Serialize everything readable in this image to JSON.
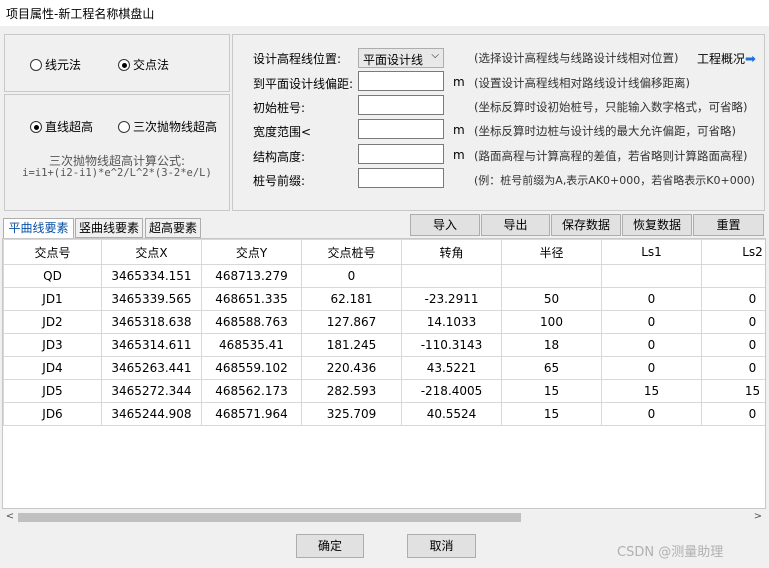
{
  "window": {
    "title": "项目属性-新工程名称棋盘山"
  },
  "modes": {
    "xianyuan": "线元法",
    "jiaodian": "交点法",
    "selected": "交点法"
  },
  "superelevation": {
    "zhixian": "直线超高",
    "sanci": "三次抛物线超高",
    "selected": "直线超高",
    "formula_title": "三次抛物线超高计算公式:",
    "formula": "i=i1+(i2-i1)*e^2/L^2*(3-2*e/L)"
  },
  "form": {
    "position_label": "设计高程线位置:",
    "position_value": "平面设计线",
    "position_hint": "(选择设计高程线与线路设计线相对位置)",
    "overview_label": "工程概况",
    "offset_label": "到平面设计线偏距:",
    "offset_unit": "m",
    "offset_hint": "(设置设计高程线相对路线设计线偏移距离)",
    "start_label": "初始桩号:",
    "start_hint": "(坐标反算时设初始桩号，只能输入数字格式，可省略)",
    "width_label": "宽度范围<",
    "width_unit": "m",
    "width_hint": "(坐标反算时边桩与设计线的最大允许偏距，可省略)",
    "struct_label": "结构高度:",
    "struct_unit": "m",
    "struct_hint": "(路面高程与计算高程的差值，若省略则计算路面高程)",
    "prefix_label": "桩号前缀:",
    "prefix_hint": "(例：桩号前缀为A,表示AK0+000，若省略表示K0+000)"
  },
  "tabs": [
    "平曲线要素",
    "竖曲线要素",
    "超高要素"
  ],
  "actions": [
    "导入",
    "导出",
    "保存数据",
    "恢复数据",
    "重置"
  ],
  "table": {
    "headers": [
      "交点号",
      "交点X",
      "交点Y",
      "交点桩号",
      "转角",
      "半径",
      "Ls1",
      "Ls2"
    ],
    "rows": [
      [
        "QD",
        "3465334.151",
        "468713.279",
        "0",
        "",
        "",
        "",
        ""
      ],
      [
        "JD1",
        "3465339.565",
        "468651.335",
        "62.181",
        "-23.2911",
        "50",
        "0",
        "0"
      ],
      [
        "JD2",
        "3465318.638",
        "468588.763",
        "127.867",
        "14.1033",
        "100",
        "0",
        "0"
      ],
      [
        "JD3",
        "3465314.611",
        "468535.41",
        "181.245",
        "-110.3143",
        "18",
        "0",
        "0"
      ],
      [
        "JD4",
        "3465263.441",
        "468559.102",
        "220.436",
        "43.5221",
        "65",
        "0",
        "0"
      ],
      [
        "JD5",
        "3465272.344",
        "468562.173",
        "282.593",
        "-218.4005",
        "15",
        "15",
        "15"
      ],
      [
        "JD6",
        "3465244.908",
        "468571.964",
        "325.709",
        "40.5524",
        "15",
        "0",
        "0"
      ]
    ]
  },
  "footer": {
    "ok": "确定",
    "cancel": "取消",
    "watermark": "CSDN @测量助理"
  }
}
